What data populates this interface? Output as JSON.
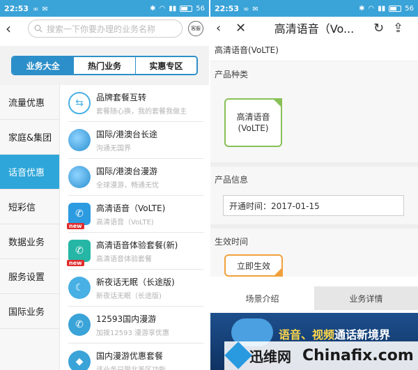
{
  "status": {
    "time": "22:53",
    "battery": "56"
  },
  "left": {
    "search_placeholder": "搜索一下你要办理的业务名称",
    "service_label": "客服",
    "tabs": [
      {
        "label": "业务大全",
        "active": true
      },
      {
        "label": "热门业务",
        "active": false
      },
      {
        "label": "实惠专区",
        "active": false
      }
    ],
    "sidebar": [
      {
        "label": "流量优惠"
      },
      {
        "label": "家庭&集团"
      },
      {
        "label": "话音优惠"
      },
      {
        "label": "短彩信"
      },
      {
        "label": "数据业务"
      },
      {
        "label": "服务设置"
      },
      {
        "label": "国际业务"
      }
    ],
    "items": [
      {
        "title": "品牌套餐互转",
        "subtitle": "套餐随心换，我的套餐我做主",
        "icon": "swap-icon"
      },
      {
        "title": "国际/港澳台长途",
        "subtitle": "沟通无国界",
        "icon": "globe-icon"
      },
      {
        "title": "国际/港澳台漫游",
        "subtitle": "全球漫游，畅通无忧",
        "icon": "globe-icon"
      },
      {
        "title": "高清语音（VoLTE)",
        "subtitle": "高清语音（VoLTE)",
        "icon": "phone-icon",
        "badge": "new"
      },
      {
        "title": "高清语音体验套餐(新)",
        "subtitle": "高清语音体验套餐",
        "icon": "phone-icon",
        "badge": "new"
      },
      {
        "title": "新夜话无眠（长途版)",
        "subtitle": "新夜话无眠（长途版)",
        "icon": "moon-phone-icon"
      },
      {
        "title": "12593国内漫游",
        "subtitle": "加拨12593 漫游享优惠",
        "icon": "phone-icon"
      },
      {
        "title": "国内漫游优惠套餐",
        "subtitle": "该业务只限北美区功能",
        "icon": "map-icon"
      }
    ]
  },
  "right": {
    "title": "高清语音（Vo...",
    "breadcrumb": "高清语音(VoLTE)",
    "product_type_label": "产品种类",
    "product_name": "高清语音(VoLTE)",
    "product_info_label": "产品信息",
    "open_time": "开通时间：2017-01-15",
    "effective_label": "生效时间",
    "effective_button": "立即生效",
    "tabs": [
      {
        "label": "场景介绍"
      },
      {
        "label": "业务详情"
      }
    ],
    "banner_text_a": "语音、视频",
    "banner_text_b": "通话新境界"
  },
  "watermark": {
    "left": "迅维网",
    "right": "Chinafix.com"
  },
  "colors": {
    "status_bar": "#3aa3d8",
    "accent": "#2d8fc9",
    "sidebar_active": "#2ea6d9",
    "card_border": "#88c056",
    "button_border": "#f0a03b"
  }
}
